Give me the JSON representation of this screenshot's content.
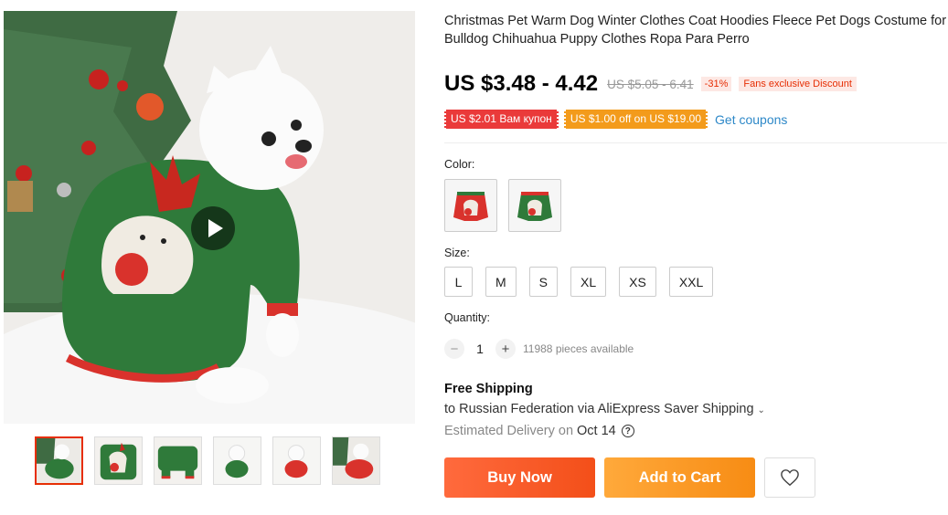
{
  "product": {
    "title": "Christmas Pet Warm Dog Winter Clothes Coat Hoodies Fleece Pet Dogs Costume for Bulldog Chihuahua Puppy Clothes Ropa Para Perro",
    "price": "US $3.48 - 4.42",
    "old_price": "US $5.05 - 6.41",
    "discount": "-31%",
    "fans_discount": "Fans exclusive Discount"
  },
  "coupons": {
    "items": [
      {
        "label": "US $2.01 Вам купон",
        "color": "#ea3a3a"
      },
      {
        "label": "US $1.00 off on US $19.00",
        "color": "#f39b1b"
      }
    ],
    "get_coupons_label": "Get coupons"
  },
  "color": {
    "label": "Color:",
    "options": [
      {
        "icon": "red-reindeer-sweater",
        "color": "#d9322c"
      },
      {
        "icon": "green-reindeer-sweater",
        "color": "#2f7a3a"
      }
    ]
  },
  "size": {
    "label": "Size:",
    "options": [
      "L",
      "M",
      "S",
      "XL",
      "XS",
      "XXL"
    ]
  },
  "quantity": {
    "label": "Quantity:",
    "minus": "−",
    "value": "1",
    "plus": "+",
    "available": "11988 pieces available"
  },
  "shipping": {
    "title": "Free Shipping",
    "to": "to Russian Federation via AliExpress Saver Shipping",
    "chevron": "⌄",
    "estimated_label": "Estimated Delivery on",
    "date": "Oct 14",
    "help": "?"
  },
  "actions": {
    "buy_now": "Buy Now",
    "add_to_cart": "Add to Cart",
    "wishlist_icon": "heart-icon"
  },
  "gallery": {
    "video_icon": "play-icon",
    "active_index": 0,
    "thumbnail_count": 6
  },
  "colors": {
    "accent_red": "#e62e04",
    "buy_now": "#f34f19",
    "add_to_cart": "#f78c14",
    "link_blue": "#2d88c8"
  }
}
